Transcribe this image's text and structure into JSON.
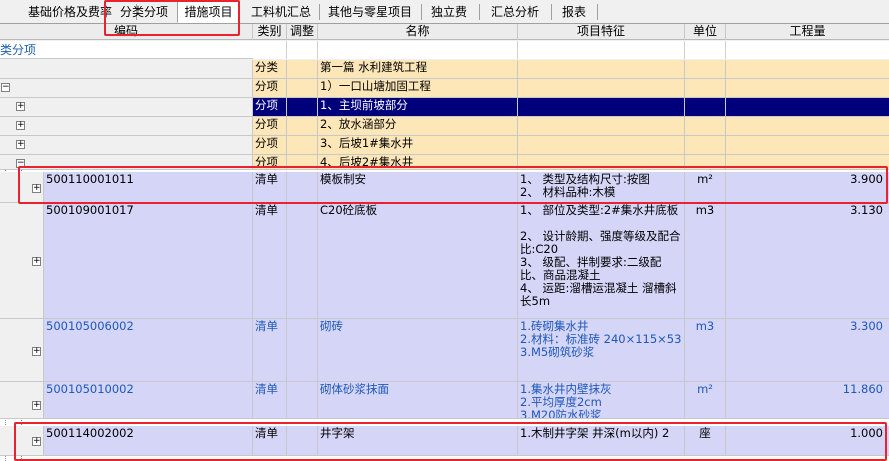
{
  "tabs": [
    {
      "label": "基础价格及费率",
      "active": false
    },
    {
      "label": "分类分项",
      "active": false
    },
    {
      "label": "措施项目",
      "active": true
    },
    {
      "label": "工料机汇总",
      "active": false
    },
    {
      "label": "其他与零星项目",
      "active": false
    },
    {
      "label": "独立费",
      "active": false
    },
    {
      "label": "汇总分析",
      "active": false
    },
    {
      "label": "报表",
      "active": false
    }
  ],
  "columns": {
    "code": "编码",
    "type": "类别",
    "adjust": "调整",
    "name": "名称",
    "feature": "项目特征",
    "unit": "单位",
    "qty": "工程量"
  },
  "filter_label": "类分项",
  "rows": [
    {
      "kind": "fenlei",
      "type": "分类",
      "name": "第一篇 水利建筑工程",
      "expander": ""
    },
    {
      "kind": "fenxiang",
      "type": "分项",
      "name": "1）一口山塘加固工程",
      "expander": "−"
    },
    {
      "kind": "selected",
      "type": "分项",
      "name": "1、主坝前坡部分",
      "expander": "+"
    },
    {
      "kind": "fenxiang",
      "type": "分项",
      "name": "2、放水涵部分",
      "expander": "+"
    },
    {
      "kind": "fenxiang",
      "type": "分项",
      "name": "3、后坡1#集水井",
      "expander": "+"
    },
    {
      "kind": "fenxiang",
      "type": "分项",
      "name": "4、后坡2#集水井",
      "expander": "−"
    },
    {
      "kind": "qingdan",
      "code": "500110001011",
      "type": "清单",
      "name": "模板制安",
      "feature": "1、 类型及结构尺寸:按图\n2、 材料品种:木模",
      "unit": "m²",
      "qty": "3.900",
      "expander": "+",
      "blue": false
    },
    {
      "kind": "qingdan",
      "code": "500109001017",
      "type": "清单",
      "name": "C20砼底板",
      "feature": "1、 部位及类型:2#集水井底板\n\n2、 设计龄期、强度等级及配合比:C20\n3、 级配、拌制要求:二级配比、商品混凝土\n4、 运距:溜槽运混凝土 溜槽斜长5m",
      "unit": "m3",
      "qty": "3.130",
      "expander": "+",
      "blue": false
    },
    {
      "kind": "qingdan",
      "code": "500105006002",
      "type": "清单",
      "name": "砌砖",
      "feature": "1.砖砌集水井\n2.材料：标准砖 240×115×53\n3.M5砌筑砂浆",
      "unit": "m3",
      "qty": "3.300",
      "expander": "+",
      "blue": true
    },
    {
      "kind": "qingdan",
      "code": "500105010002",
      "type": "清单",
      "name": "砌体砂浆抹面",
      "feature": "1.集水井内壁抹灰\n2.平均厚度2cm\n3.M20防水砂浆",
      "unit": "m²",
      "qty": "11.860",
      "expander": "+",
      "blue": true
    },
    {
      "kind": "qingdan",
      "code": "500114002002",
      "type": "清单",
      "name": "井字架",
      "feature": "1.木制井字架 井深(m以内) 2",
      "unit": "座",
      "qty": "1.000",
      "expander": "+",
      "blue": false
    }
  ]
}
